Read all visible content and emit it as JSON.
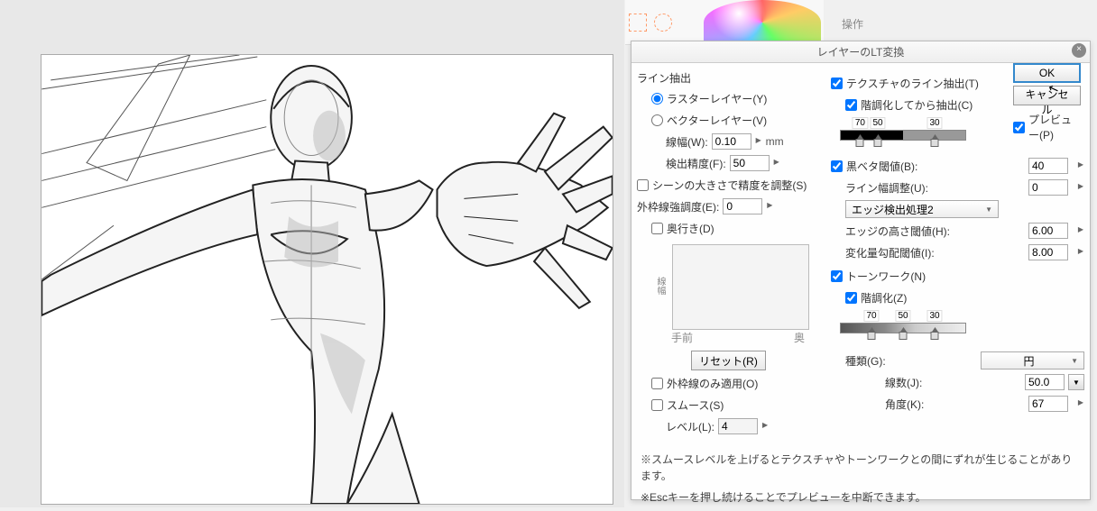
{
  "ops_label": "操作",
  "dialog": {
    "title": "レイヤーのLT変換",
    "left": {
      "line_extract": "ライン抽出",
      "raster_layer": "ラスターレイヤー(Y)",
      "vector_layer": "ベクターレイヤー(V)",
      "line_width_label": "線幅(W):",
      "line_width_value": "0.10",
      "line_width_unit": "mm",
      "precision_label": "検出精度(F):",
      "precision_value": "50",
      "scene_scale": "シーンの大きさで精度を調整(S)",
      "outline_label": "外枠線強調度(E):",
      "outline_value": "0",
      "depth_cb": "奥行き(D)",
      "depth_side_label": "線幅",
      "front_label": "手前",
      "back_label": "奥",
      "reset_btn": "リセット(R)",
      "outline_only": "外枠線のみ適用(O)",
      "smooth_cb": "スムース(S)",
      "level_label": "レベル(L):",
      "level_value": "4"
    },
    "right": {
      "texture_line": "テクスチャのライン抽出(T)",
      "posterize_extract": "階調化してから抽出(C)",
      "grad1": {
        "v1": "70",
        "v2": "50",
        "v3": "30"
      },
      "black_beta_label": "黒ベタ閾値(B):",
      "black_beta_value": "40",
      "line_width_adj_label": "ライン幅調整(U):",
      "line_width_adj_value": "0",
      "edge_detect": "エッジ検出処理2",
      "edge_height_label": "エッジの高さ閾値(H):",
      "edge_height_value": "6.00",
      "gradient_label": "変化量勾配閾値(I):",
      "gradient_value": "8.00",
      "tonework": "トーンワーク(N)",
      "posterize": "階調化(Z)",
      "grad2": {
        "v1": "70",
        "v2": "50",
        "v3": "30"
      },
      "type_label": "種類(G):",
      "type_value": "円",
      "lines_label": "線数(J):",
      "lines_value": "50.0",
      "angle_label": "角度(K):",
      "angle_value": "67"
    },
    "buttons": {
      "ok": "OK",
      "cancel": "キャンセル",
      "preview": "プレビュー(P)"
    },
    "footer": {
      "note1": "※スムースレベルを上げるとテクスチャやトーンワークとの間にずれが生じることがあります。",
      "note2": "※Escキーを押し続けることでプレビューを中断できます。"
    }
  }
}
